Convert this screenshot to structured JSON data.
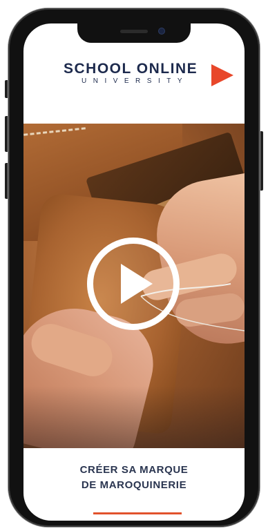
{
  "logo": {
    "name": "SCHOOL ONLINE",
    "subtitle": "UNIVERSITY",
    "accent_color": "#e8472a",
    "text_color": "#1d2a4d"
  },
  "video": {
    "icon": "play-icon"
  },
  "course": {
    "title_line1": "CRÉER SA MARQUE",
    "title_line2": "DE MAROQUINERIE",
    "underline_color": "#e2522c"
  }
}
